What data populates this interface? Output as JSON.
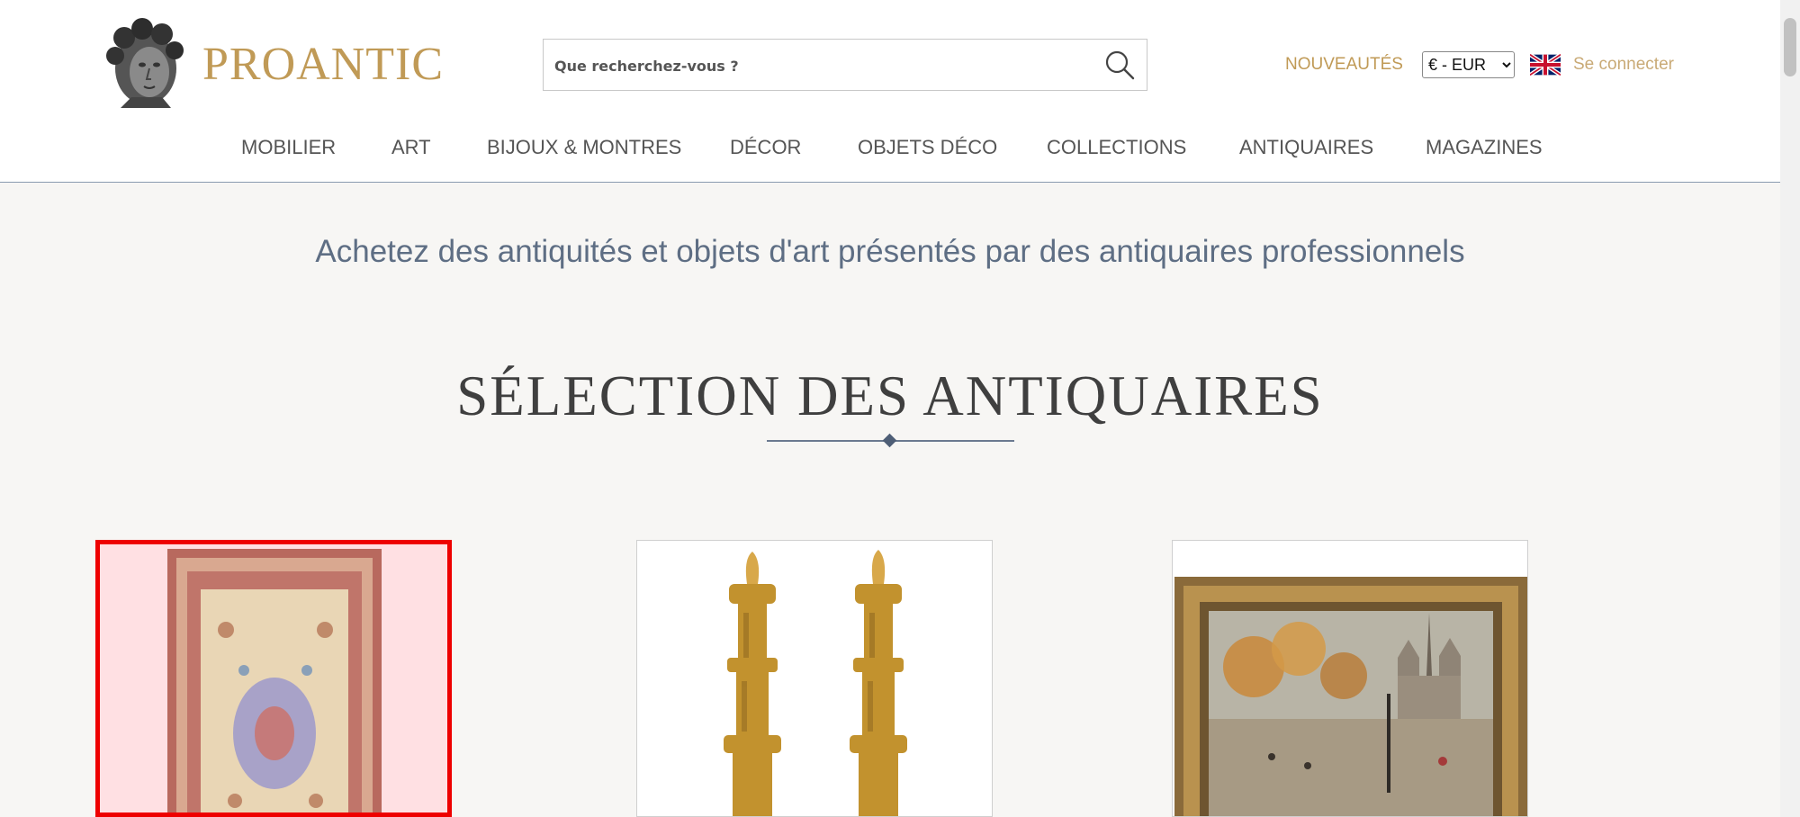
{
  "header": {
    "logo_text": "PROANTIC",
    "search_placeholder": "Que recherchez-vous ?",
    "nouveautes": "NOUVEAUTÉS",
    "currency": "€ - EUR",
    "login": "Se connecter",
    "flag_icon": "uk-flag-icon"
  },
  "nav": {
    "items": [
      "MOBILIER",
      "ART",
      "BIJOUX & MONTRES",
      "DÉCOR",
      "OBJETS DÉCO",
      "COLLECTIONS",
      "ANTIQUAIRES",
      "MAGAZINES"
    ]
  },
  "main": {
    "tagline": "Achetez des antiquités et objets d'art présentés par des antiquaires professionnels",
    "section_title": "SÉLECTION DES ANTIQUAIRES"
  },
  "cards": [
    {
      "image": "persian-rug-image",
      "selected": true
    },
    {
      "image": "gilt-bronze-candlesticks-image",
      "selected": false
    },
    {
      "image": "framed-paris-painting-image",
      "selected": false
    }
  ],
  "colors": {
    "gold": "#c09a56",
    "slate": "#5e6e84",
    "selection": "#ee0000"
  }
}
